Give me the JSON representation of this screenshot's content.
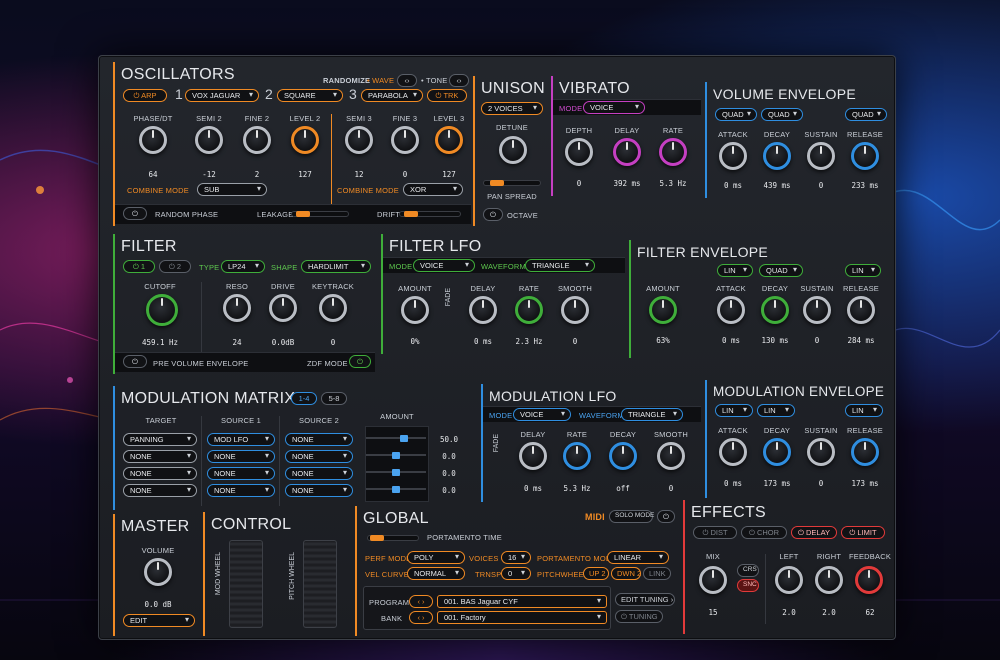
{
  "osc": {
    "title": "OSCILLATORS",
    "randomize": "RANDOMIZE",
    "wave": "WAVE",
    "tone": "TONE",
    "arp": "ARP",
    "n1": "1",
    "osc1_wave": "VOX JAGUAR",
    "n2": "2",
    "osc2_wave": "SQUARE",
    "n3": "3",
    "osc3_wave": "PARABOLA",
    "trk": "TRK",
    "knob_labels": [
      "PHASE/DT",
      "SEMI 2",
      "FINE 2",
      "LEVEL 2",
      "SEMI 3",
      "FINE 3",
      "LEVEL 3"
    ],
    "knob_values": [
      "64",
      "-12",
      "2",
      "127",
      "12",
      "0",
      "127"
    ],
    "combine": "COMBINE MODE",
    "combine1": "SUB",
    "combine2": "XOR",
    "random_phase": "RANDOM PHASE",
    "leakage": "LEAKAGE",
    "drift": "DRIFT"
  },
  "unison": {
    "title": "UNISON",
    "voices": "2 VOICES",
    "detune": "DETUNE",
    "pan_spread": "PAN SPREAD",
    "octave": "OCTAVE"
  },
  "vibrato": {
    "title": "VIBRATO",
    "mode": "MODE",
    "mode_val": "VOICE",
    "labels": [
      "DEPTH",
      "DELAY",
      "RATE"
    ],
    "values": [
      "0",
      "392 ms",
      "5.3 Hz"
    ]
  },
  "volenv": {
    "title": "VOLUME ENVELOPE",
    "curves": [
      "QUAD",
      "QUAD",
      "QUAD"
    ],
    "labels": [
      "ATTACK",
      "DECAY",
      "SUSTAIN",
      "RELEASE"
    ],
    "values": [
      "0 ms",
      "439 ms",
      "0",
      "233 ms"
    ]
  },
  "filter": {
    "title": "FILTER",
    "f1": "1",
    "f2": "2",
    "type": "TYPE",
    "type_val": "LP24",
    "shape": "SHAPE",
    "shape_val": "HARDLIMIT",
    "labels": [
      "CUTOFF",
      "RESO",
      "DRIVE",
      "KEYTRACK"
    ],
    "values": [
      "459.1 Hz",
      "24",
      "0.0dB",
      "0"
    ],
    "pre_vol": "PRE VOLUME ENVELOPE",
    "zdf": "ZDF MODE"
  },
  "filterlfo": {
    "title": "FILTER LFO",
    "mode": "MODE",
    "mode_val": "VOICE",
    "waveform": "WAVEFORM",
    "waveform_val": "TRIANGLE",
    "fade": "FADE",
    "labels": [
      "AMOUNT",
      "DELAY",
      "RATE",
      "SMOOTH"
    ],
    "values": [
      "0%",
      "0 ms",
      "2.3 Hz",
      "0"
    ]
  },
  "filterenv": {
    "title": "FILTER ENVELOPE",
    "curves": [
      "LIN",
      "QUAD",
      "LIN"
    ],
    "labels": [
      "AMOUNT",
      "ATTACK",
      "DECAY",
      "SUSTAIN",
      "RELEASE"
    ],
    "values": [
      "63%",
      "0 ms",
      "130 ms",
      "0",
      "284 ms"
    ]
  },
  "modmatrix": {
    "title": "MODULATION MATRIX",
    "page1": "1-4",
    "page2": "5-8",
    "h_target": "TARGET",
    "h_src1": "SOURCE 1",
    "h_src2": "SOURCE 2",
    "h_amount": "AMOUNT",
    "rows": [
      {
        "target": "PANNING",
        "src1": "MOD LFO",
        "src2": "NONE",
        "amount": "50.0"
      },
      {
        "target": "NONE",
        "src1": "NONE",
        "src2": "NONE",
        "amount": "0.0"
      },
      {
        "target": "NONE",
        "src1": "NONE",
        "src2": "NONE",
        "amount": "0.0"
      },
      {
        "target": "NONE",
        "src1": "NONE",
        "src2": "NONE",
        "amount": "0.0"
      }
    ]
  },
  "modlfo": {
    "title": "MODULATION LFO",
    "mode": "MODE",
    "mode_val": "VOICE",
    "waveform": "WAVEFORM",
    "waveform_val": "TRIANGLE",
    "fade": "FADE",
    "labels": [
      "DELAY",
      "RATE",
      "DECAY",
      "SMOOTH"
    ],
    "values": [
      "0 ms",
      "5.3 Hz",
      "off",
      "0"
    ]
  },
  "modenv": {
    "title": "MODULATION ENVELOPE",
    "curves": [
      "LIN",
      "LIN",
      "LIN"
    ],
    "labels": [
      "ATTACK",
      "DECAY",
      "SUSTAIN",
      "RELEASE"
    ],
    "values": [
      "0 ms",
      "173 ms",
      "0",
      "173 ms"
    ]
  },
  "effects": {
    "title": "EFFECTS",
    "tabs": [
      "DIST",
      "CHOR",
      "DELAY",
      "LIMIT"
    ],
    "labels": [
      "MIX",
      "LEFT",
      "RIGHT",
      "FEEDBACK"
    ],
    "crs": "CRS",
    "snc": "SNC",
    "values": [
      "15",
      "2.0",
      "2.0",
      "62"
    ]
  },
  "master": {
    "title": "MASTER",
    "volume": "VOLUME",
    "volume_val": "0.0 dB",
    "edit": "EDIT"
  },
  "control": {
    "title": "CONTROL",
    "mod_wheel": "MOD WHEEL",
    "pitch_wheel": "PITCH WHEEL"
  },
  "global": {
    "title": "GLOBAL",
    "midi": "MIDI",
    "solo": "SOLO MODE",
    "portamento_time": "PORTAMENTO TIME",
    "perf_mode": "PERF MODE",
    "perf_val": "POLY",
    "voices": "VOICES",
    "voices_val": "16",
    "port_mode": "PORTAMENTO MODE",
    "port_val": "LINEAR",
    "vel_curve": "VEL CURVE",
    "vel_val": "NORMAL",
    "transp": "TRNSP",
    "transp_val": "0",
    "pitchwheel": "PITCHWHEEL",
    "up": "UP 2",
    "dwn": "DWN 2",
    "link": "LINK",
    "edit_tuning": "EDIT TUNING",
    "tuning": "TUNING",
    "program": "PROGRAM",
    "program_val": "001. BAS Jaguar CYF",
    "bank": "BANK",
    "bank_val": "001. Factory"
  },
  "colors": {
    "orange": "#f08a24",
    "cyan": "#2f8ee0",
    "green": "#3fae3a",
    "pink": "#c53fc2",
    "red": "#e23a3a"
  }
}
